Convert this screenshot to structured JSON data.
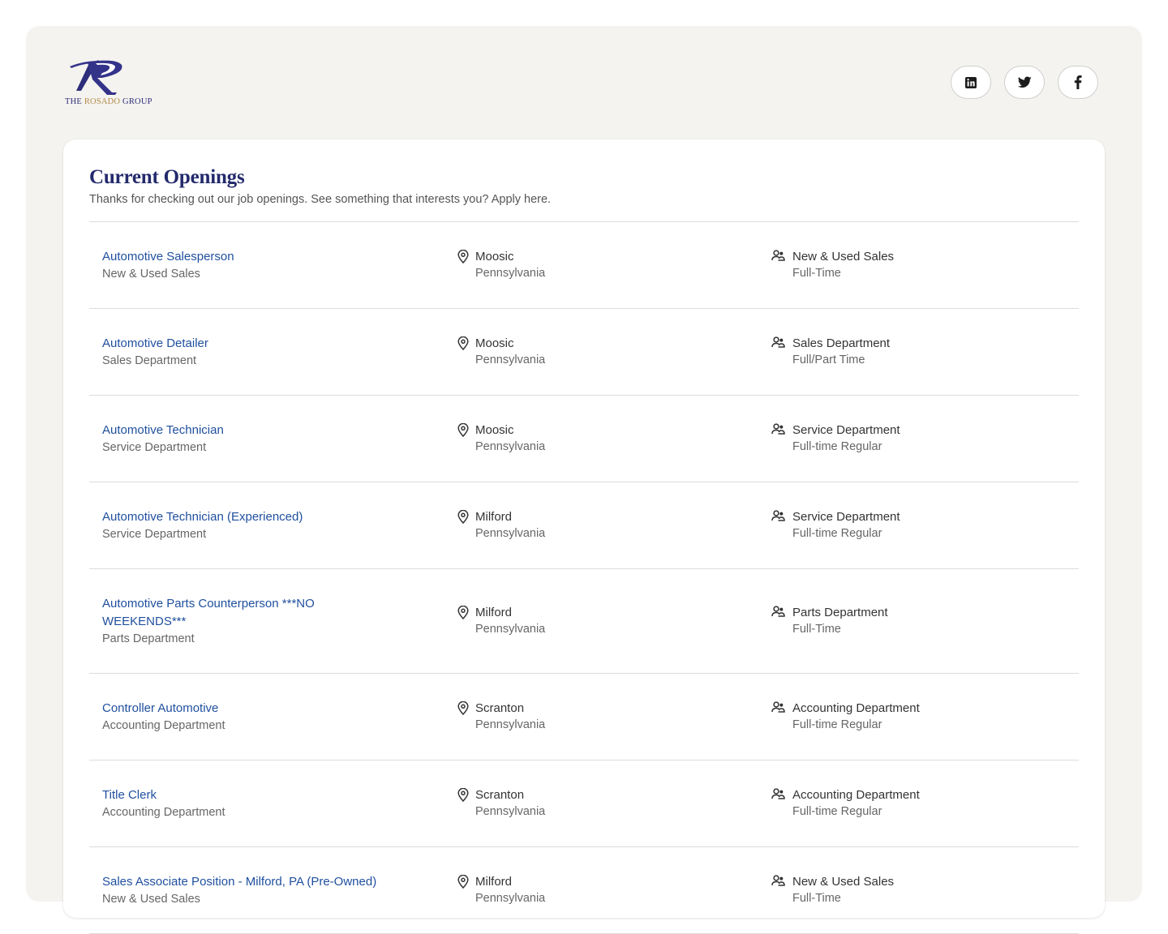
{
  "brand": {
    "logo_text_prefix": "THE ",
    "logo_text_main": "ROSADO",
    "logo_text_suffix": " GROUP"
  },
  "social": {
    "linkedin": "linkedin-icon",
    "twitter": "twitter-icon",
    "facebook": "facebook-icon"
  },
  "page": {
    "title": "Current Openings",
    "subtitle": "Thanks for checking out our job openings. See something that interests you? Apply here."
  },
  "colors": {
    "title": "#232a6c",
    "link": "#1f4f9e",
    "panel": "#f4f3ef",
    "logo_gold": "#b48b4a"
  },
  "jobs": [
    {
      "title": "Automotive Salesperson",
      "department": "New & Used Sales",
      "city": "Moosic",
      "state": "Pennsylvania",
      "team": "New & Used Sales",
      "type": "Full-Time"
    },
    {
      "title": "Automotive Detailer",
      "department": "Sales Department",
      "city": "Moosic",
      "state": "Pennsylvania",
      "team": "Sales Department",
      "type": "Full/Part Time"
    },
    {
      "title": "Automotive Technician",
      "department": "Service Department",
      "city": "Moosic",
      "state": "Pennsylvania",
      "team": "Service Department",
      "type": "Full-time Regular"
    },
    {
      "title": "Automotive Technician (Experienced)",
      "department": "Service Department",
      "city": "Milford",
      "state": "Pennsylvania",
      "team": "Service Department",
      "type": "Full-time Regular"
    },
    {
      "title": "Automotive Parts Counterperson ***NO WEEKENDS***",
      "department": "Parts Department",
      "city": "Milford",
      "state": "Pennsylvania",
      "team": "Parts Department",
      "type": "Full-Time"
    },
    {
      "title": "Controller Automotive",
      "department": "Accounting Department",
      "city": "Scranton",
      "state": "Pennsylvania",
      "team": "Accounting Department",
      "type": "Full-time Regular"
    },
    {
      "title": "Title Clerk",
      "department": "Accounting Department",
      "city": "Scranton",
      "state": "Pennsylvania",
      "team": "Accounting Department",
      "type": "Full-time Regular"
    },
    {
      "title": "Sales Associate Position - Milford, PA (Pre-Owned)",
      "department": "New & Used Sales",
      "city": "Milford",
      "state": "Pennsylvania",
      "team": "New & Used Sales",
      "type": "Full-Time"
    }
  ]
}
